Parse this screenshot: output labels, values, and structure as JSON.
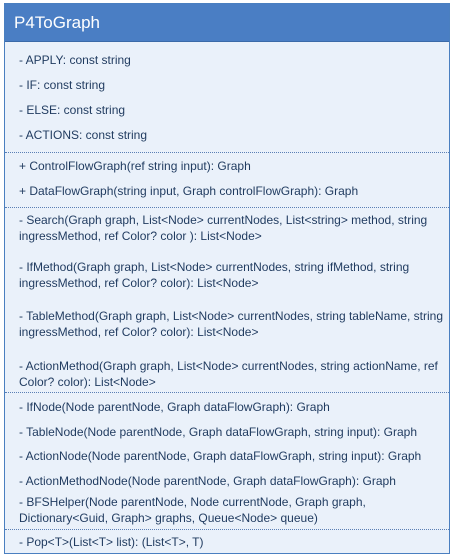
{
  "class_name": "P4ToGraph",
  "fields": [
    "- APPLY: const string",
    "- IF: const string",
    "- ELSE: const string",
    "- ACTIONS: const string"
  ],
  "public_methods": [
    "+ ControlFlowGraph(ref string input): Graph",
    "+ DataFlowGraph(string input, Graph controlFlowGraph): Graph"
  ],
  "private_methods_a": [
    "- Search(Graph graph, List<Node> currentNodes, List<string> method, string ingressMethod, ref Color? color ): List<Node>",
    "- IfMethod(Graph graph, List<Node> currentNodes, string ifMethod, string ingressMethod, ref Color? color): List<Node>",
    "- TableMethod(Graph graph, List<Node> currentNodes, string tableName, string ingressMethod, ref Color? color): List<Node>",
    "- ActionMethod(Graph graph, List<Node> currentNodes, string actionName, ref Color? color): List<Node>"
  ],
  "private_methods_b": [
    "- IfNode(Node parentNode, Graph dataFlowGraph): Graph",
    "- TableNode(Node parentNode, Graph dataFlowGraph, string input): Graph",
    "- ActionNode(Node parentNode, Graph dataFlowGraph, string input): Graph",
    "- ActionMethodNode(Node parentNode, Graph dataFlowGraph): Graph",
    "- BFSHelper(Node parentNode, Node currentNode, Graph graph, Dictionary<Guid, Graph> graphs, Queue<Node> queue)"
  ],
  "generic_methods": [
    "- Pop<T>(List<T> list): (List<T>, T)"
  ]
}
